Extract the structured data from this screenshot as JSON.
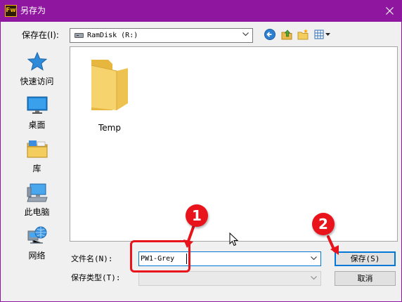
{
  "window": {
    "app_icon_text": "Fw",
    "title": "另存为",
    "titlebar_color": "#8f169f",
    "close_icon": "close-icon"
  },
  "toolbar": {
    "save_in_label": "保存在(I):",
    "save_in_value": "RamDisk (R:)",
    "icons": [
      "back-icon",
      "up-folder-icon",
      "new-folder-icon",
      "view-menu-icon"
    ]
  },
  "places": [
    {
      "label": "快速访问",
      "icon": "quick-access-star-icon"
    },
    {
      "label": "桌面",
      "icon": "desktop-icon"
    },
    {
      "label": "库",
      "icon": "library-icon"
    },
    {
      "label": "此电脑",
      "icon": "this-pc-icon"
    },
    {
      "label": "网络",
      "icon": "network-icon"
    }
  ],
  "files": [
    {
      "name": "Temp",
      "icon": "folder-icon"
    }
  ],
  "form": {
    "filename_label": "文件名(N):",
    "filename_value": "PW1-Grey",
    "filetype_label": "保存类型(T):",
    "filetype_value": ""
  },
  "buttons": {
    "save": "保存(S)",
    "cancel": "取消"
  },
  "annotations": {
    "badge_1": "1",
    "badge_2": "2",
    "color": "#e8131b"
  }
}
